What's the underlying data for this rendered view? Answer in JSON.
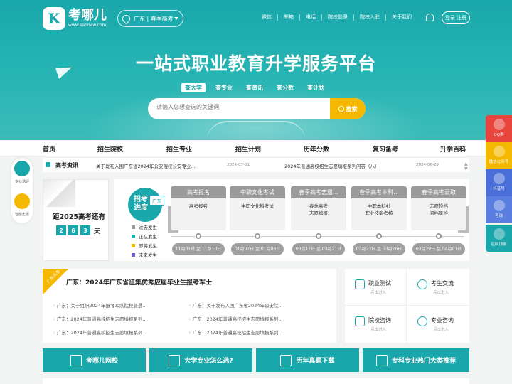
{
  "header": {
    "logo_name": "考哪儿",
    "logo_url": "www.kaonaw.com",
    "location": "广东 | 春季高考",
    "top_links": [
      "微信",
      "邮箱",
      "电话",
      "院校登录",
      "院校入驻",
      "关于我们"
    ],
    "login": "登录 注册"
  },
  "hero": {
    "slogan": "一站式职业教育升学服务平台",
    "search_tabs": [
      "查大学",
      "查专业",
      "查资讯",
      "查分数",
      "查计划"
    ],
    "active_tab": "查大学",
    "search_placeholder": "请输入您想查询的关键词",
    "search_button": "搜索"
  },
  "main_nav": [
    "首页",
    "招生院校",
    "招生专业",
    "招生计划",
    "历年分数",
    "复习备考",
    "升学百科"
  ],
  "ticker": {
    "label": "高考资讯",
    "items": [
      {
        "title": "关于发布入围广东省2024年公安院校公安专业...",
        "date": "2024-07-01"
      },
      {
        "title": "2024年普通高校招生志愿填报系列问答（八）",
        "date": "2024-06-29"
      }
    ]
  },
  "side_left": [
    {
      "label": "专业测评"
    },
    {
      "label": "智能志愿"
    }
  ],
  "countdown": {
    "title": "距2025高考还有",
    "digits": [
      "2",
      "6",
      "3"
    ],
    "unit": "天"
  },
  "timeline": {
    "badge": "招考\n进度",
    "region": "广东",
    "legend": [
      {
        "label": "过去发生",
        "color": "#9a9a9a"
      },
      {
        "label": "正在发生",
        "color": "#1aa7ab"
      },
      {
        "label": "即将发生",
        "color": "#f5b800"
      },
      {
        "label": "未来发生",
        "color": "#6a5acd"
      }
    ],
    "cards": [
      {
        "title": "高考报名",
        "body": "高考报名",
        "date": "11月01日 至 11月10日"
      },
      {
        "title": "中职文化考试",
        "body": "中职文化科考试",
        "date": "01月07日 至 01月08日"
      },
      {
        "title": "春季高考志愿...",
        "body": "春季高考\n志愿填报",
        "date": "03月17日 至 03月21日"
      },
      {
        "title": "春季高考本科...",
        "body": "中职本科批\n职业技能考核",
        "date": "03月23日 至 03月26日"
      },
      {
        "title": "春季高考录取",
        "body": "志愿投档\n阅档录检",
        "date": "03月29日 至 04月01日"
      }
    ]
  },
  "news": {
    "ribbon": "广东头条",
    "headline": "广东：2024年广东省征集优秀应届毕业生报考军士",
    "items": [
      "广东：关于组织2024年报考军队院校普通...",
      "广东：关于发布入围广东省2024年公安院...",
      "广东：2024年普通高校招生志愿填报系列...",
      "广东：2024年普通高校招生志愿填报系列...",
      "广东：2024年普通高校招生志愿填报系列...",
      "广东：2024年普通高校招生志愿填报系列..."
    ]
  },
  "quick": [
    {
      "title": "职业测试",
      "sub": "点击进入"
    },
    {
      "title": "考生交流",
      "sub": "点击进入"
    },
    {
      "title": "院校咨询",
      "sub": "点击进入"
    },
    {
      "title": "专业咨询",
      "sub": "点击进入"
    }
  ],
  "bottom_buttons": [
    "考哪儿网校",
    "大学专业怎么选?",
    "历年真题下载",
    "专科专业热门大类推荐"
  ],
  "float_bar": [
    {
      "label": "QQ群",
      "color": "#e8453c"
    },
    {
      "label": "微信公众号",
      "color": "#f5b800"
    },
    {
      "label": "抖音号",
      "color": "#4a6fd8"
    },
    {
      "label": "咨询",
      "color": "#4a6fd8"
    },
    {
      "label": "返回顶部",
      "color": "#1aa7ab"
    }
  ]
}
